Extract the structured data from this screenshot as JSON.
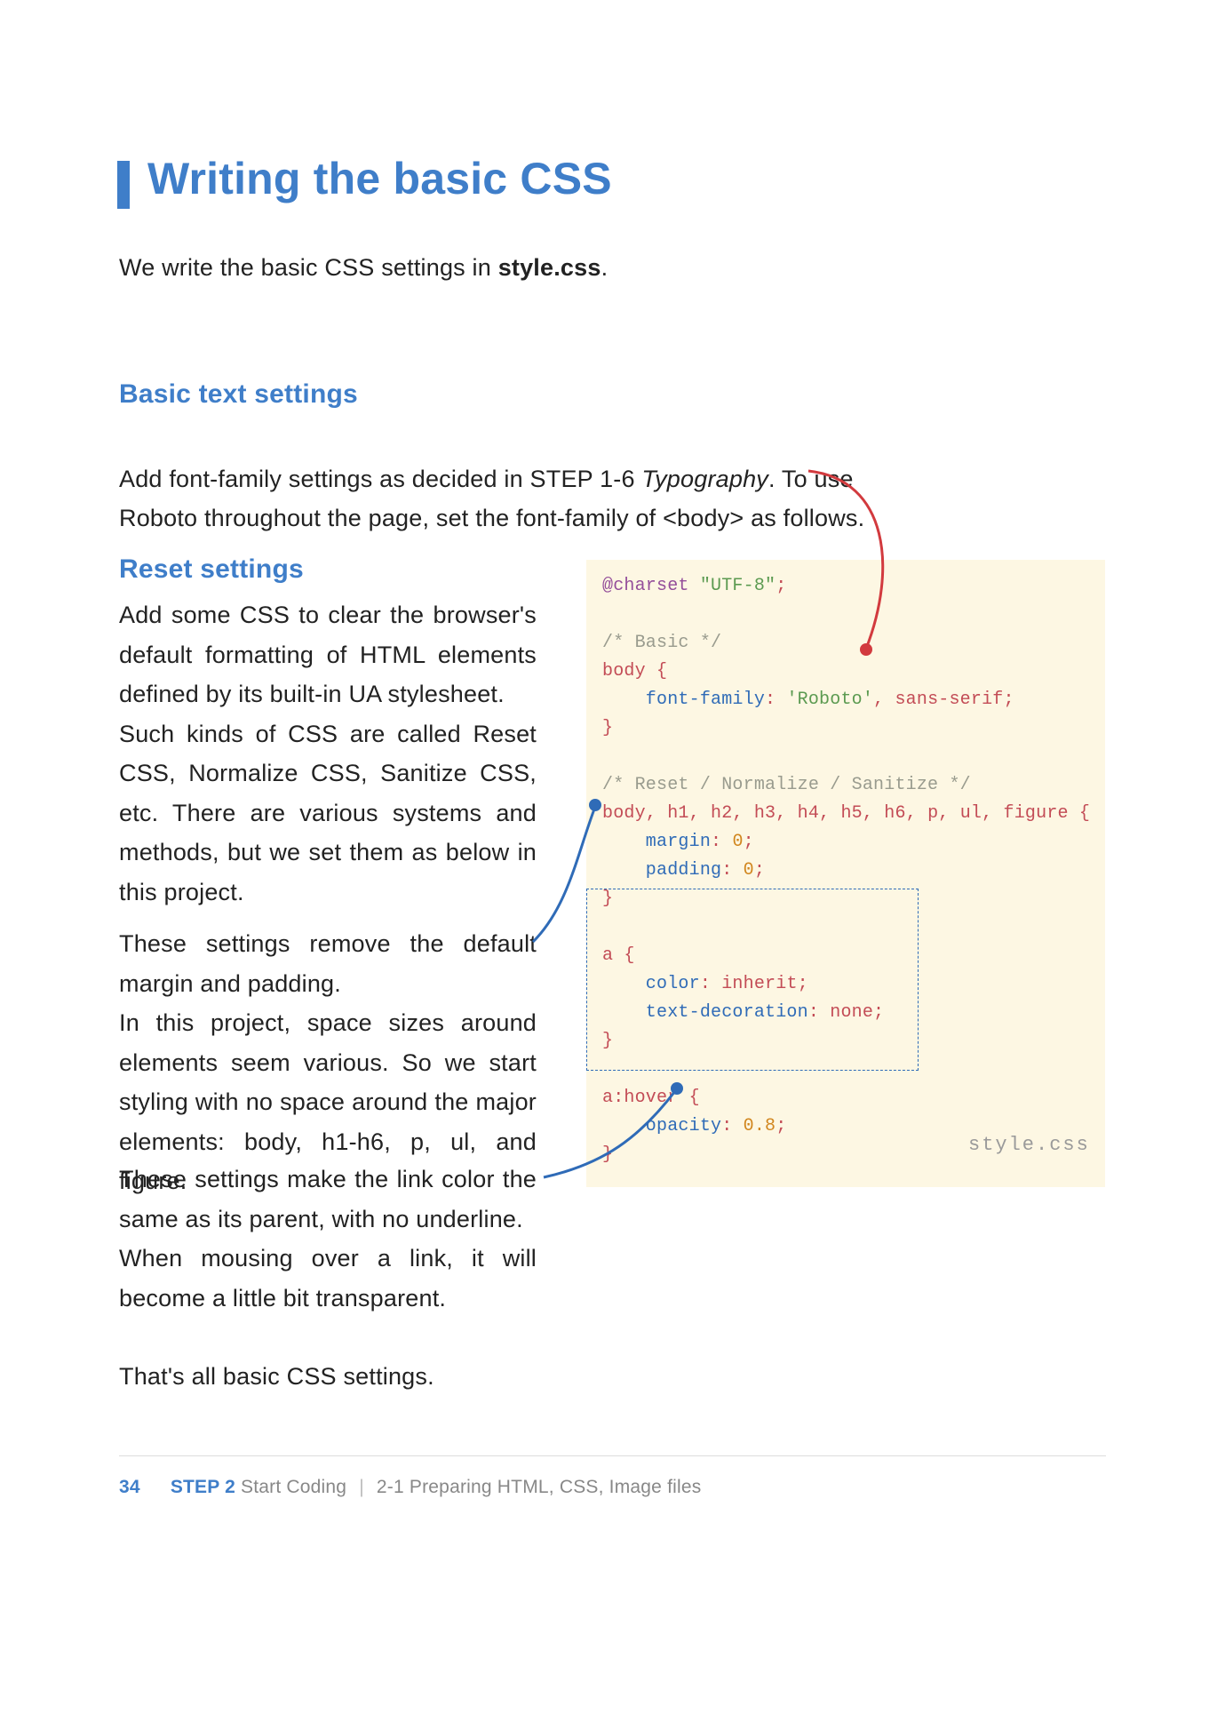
{
  "title": "Writing the basic CSS",
  "intro_a": "We write the basic CSS settings in ",
  "intro_b": "style.css",
  "intro_c": ".",
  "sh1": "Basic text settings",
  "p1_a": "Add font-family settings as decided in STEP 1-6 ",
  "p1_b": "Typography",
  "p1_c": ". To use Roboto throughout the page, set the font-family of <body> as follows.",
  "sh2": "Reset settings",
  "p2": "Add some CSS to clear the browser's default formatting of HTML elements defined by its built-in UA stylesheet.\nSuch kinds of CSS are called Reset CSS, Normalize CSS, Sanitize CSS, etc. There are various systems and methods, but we set them as below in this project.",
  "p3": "These settings remove the default margin and padding.\nIn this project, space sizes around elements seem various. So we start styling with no space around the major elements: body, h1-h6, p, ul, and figure.",
  "p4": "These settings make the link color the same as its parent, with no underline.\nWhen mousing over a link, it will become a little bit transparent.",
  "p5": "That's all basic CSS settings.",
  "code_caption": "style.css",
  "code": {
    "l01a": "@charset",
    "l01b": "\"UTF-8\"",
    "l01c": ";",
    "l02": "",
    "l03": "/* Basic */",
    "l04a": "body",
    "l04b": " {",
    "l05a": "    font-family",
    "l05b": ": ",
    "l05c": "'Roboto'",
    "l05d": ", sans-serif;",
    "l06": "}",
    "l07": "",
    "l08": "/* Reset / Normalize / Sanitize */",
    "l09a": "body",
    "l09b": ", ",
    "l09c": "h1",
    "l09d": ", ",
    "l09e": "h2",
    "l09f": ", ",
    "l09g": "h3",
    "l09h": ", ",
    "l09i": "h4",
    "l09j": ", ",
    "l09k": "h5",
    "l09l": ", ",
    "l09m": "h6",
    "l09n": ", ",
    "l09o": "p",
    "l09p": ", ",
    "l09q": "ul",
    "l09r": ", ",
    "l09s": "figure",
    "l09t": " {",
    "l10a": "    margin",
    "l10b": ": ",
    "l10c": "0",
    "l10d": ";",
    "l11a": "    padding",
    "l11b": ": ",
    "l11c": "0",
    "l11d": ";",
    "l12": "}",
    "l13": "",
    "l14a": "a",
    "l14b": " {",
    "l15a": "    color",
    "l15b": ": inherit;",
    "l16a": "    text-decoration",
    "l16b": ": none;",
    "l17": "}",
    "l18": "",
    "l19a": "a",
    "l19b": ":hover",
    "l19c": " {",
    "l20a": "    opacity",
    "l20b": ": ",
    "l20c": "0.8",
    "l20d": ";",
    "l21": "}"
  },
  "footer": {
    "page": "34",
    "step": "STEP 2",
    "step_name": " Start Coding",
    "chapter": "2-1 Preparing HTML, CSS, Image files"
  }
}
